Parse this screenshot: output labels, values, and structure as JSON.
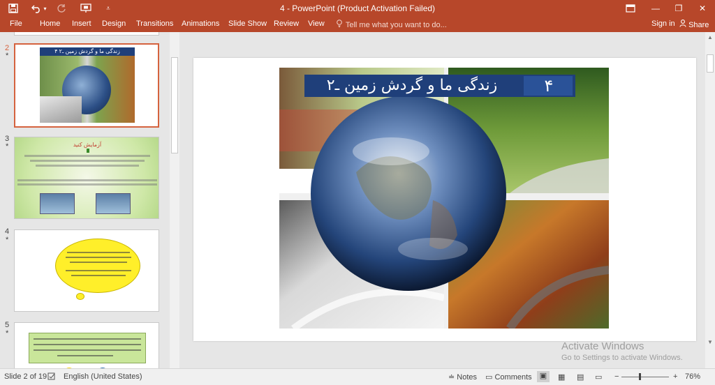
{
  "titlebar": {
    "title": "4  -  PowerPoint (Product Activation Failed)",
    "save_icon": "save-icon",
    "undo_icon": "undo-icon",
    "redo_icon": "redo-icon",
    "present_icon": "start-from-beginning-icon",
    "customize_icon": "customize-qat-icon",
    "ribbon_display_icon": "ribbon-display-options-icon",
    "minimize": "—",
    "restore": "❐",
    "close": "✕",
    "colors": {
      "accent": "#b7472a"
    }
  },
  "ribbon": {
    "tabs": [
      "File",
      "Home",
      "Insert",
      "Design",
      "Transitions",
      "Animations",
      "Slide Show",
      "Review",
      "View"
    ],
    "tell_me": "Tell me what you want to do...",
    "sign_in": "Sign in",
    "share": "Share"
  },
  "thumbnails": [
    {
      "number": "2",
      "star": "*",
      "selected": true,
      "title": "۴   زندگی ما و گردش زمین ـ۲"
    },
    {
      "number": "3",
      "star": "*",
      "selected": false,
      "heading": "آزمایش کنید"
    },
    {
      "number": "4",
      "star": "*",
      "selected": false
    },
    {
      "number": "5",
      "star": "*",
      "selected": false
    }
  ],
  "slide": {
    "title_number": "۴",
    "title_text": "زندگی ما و گردش زمین ـ۲"
  },
  "watermark": {
    "line1": "Activate Windows",
    "line2": "Go to Settings to activate Windows."
  },
  "status": {
    "slide_info": "Slide 2 of 19",
    "language": "English (United States)",
    "notes": "Notes",
    "comments": "Comments",
    "zoom": "76%",
    "zoom_level": 0.76
  }
}
